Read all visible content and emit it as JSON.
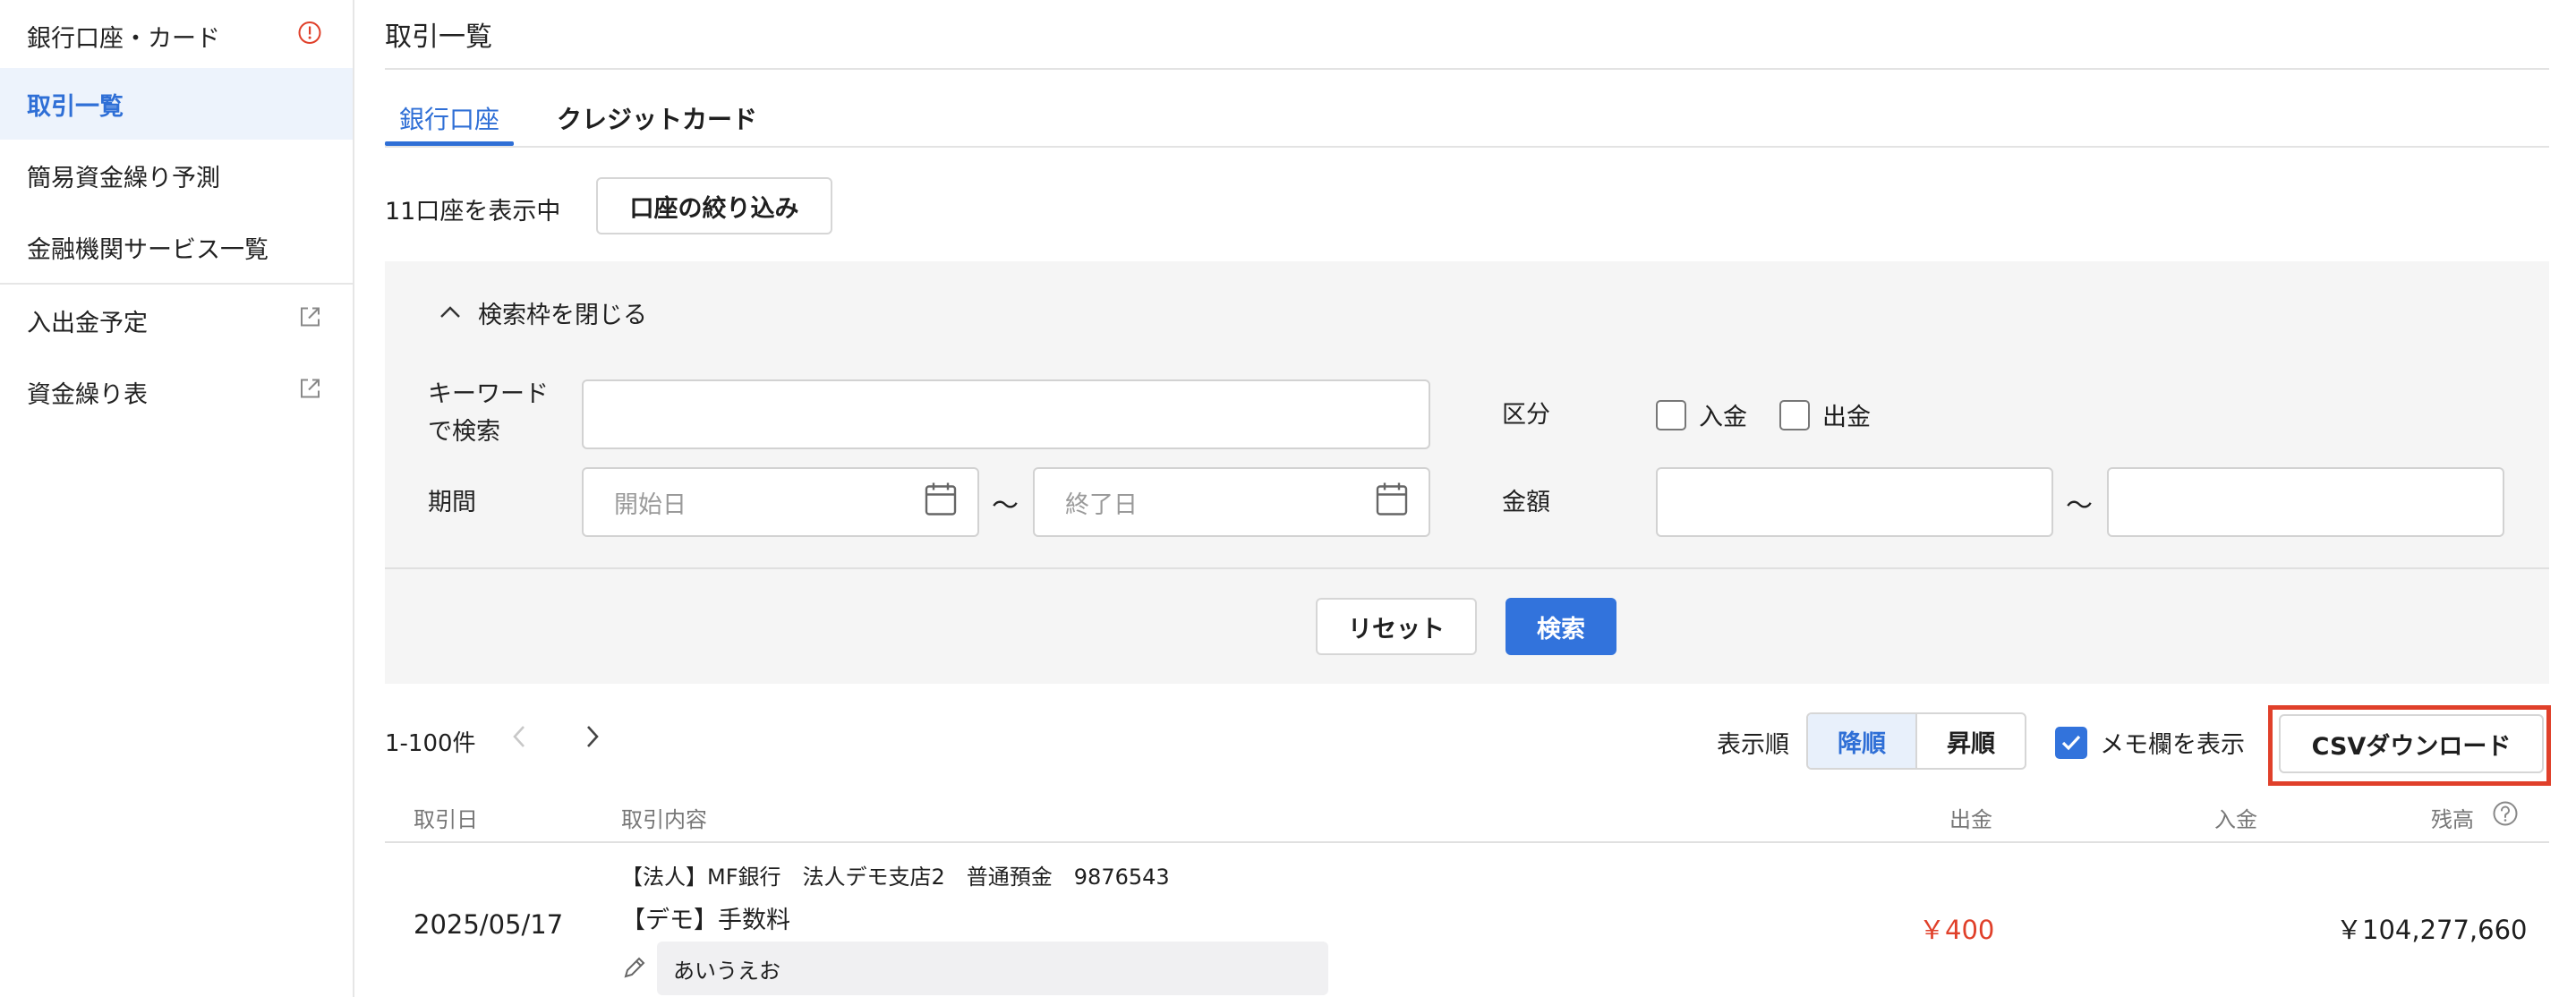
{
  "sidebar": {
    "items": [
      {
        "label": "銀行口座・カード",
        "icon": "alert-circle-icon"
      },
      {
        "label": "取引一覧",
        "active": true
      },
      {
        "label": "簡易資金繰り予測"
      },
      {
        "label": "金融機関サービス一覧"
      },
      {
        "label": "入出金予定",
        "icon": "external-link-icon"
      },
      {
        "label": "資金繰り表",
        "icon": "external-link-icon"
      }
    ]
  },
  "header": {
    "title": "取引一覧"
  },
  "tabs": [
    {
      "label": "銀行口座",
      "active": true
    },
    {
      "label": "クレジットカード"
    }
  ],
  "accounts": {
    "count_text": "11口座を表示中",
    "filter_button": "口座の絞り込み"
  },
  "search": {
    "toggle_label": "検索枠を閉じる",
    "keyword_label_line1": "キーワード",
    "keyword_label_line2": "で検索",
    "keyword_value": "",
    "period_label": "期間",
    "start_placeholder": "開始日",
    "end_placeholder": "終了日",
    "tilde": "〜",
    "category_label": "区分",
    "deposit_label": "入金",
    "withdrawal_label": "出金",
    "amount_label": "金額",
    "reset_button": "リセット",
    "search_button": "検索"
  },
  "results": {
    "range_text": "1-100件",
    "sort_label": "表示順",
    "sort_desc": "降順",
    "sort_asc": "昇順",
    "memo_toggle_label": "メモ欄を表示",
    "memo_toggle_checked": true,
    "csv_button": "CSVダウンロード"
  },
  "table": {
    "headers": {
      "date": "取引日",
      "content": "取引内容",
      "withdrawal": "出金",
      "deposit": "入金",
      "balance": "残高"
    },
    "rows": [
      {
        "date": "2025/05/17",
        "account_info": "【法人】MF銀行　法人デモ支店2　普通預金　9876543",
        "description": "【デモ】手数料",
        "memo": "あいうえお",
        "withdrawal": "￥400",
        "deposit": "",
        "balance": "￥104,277,660"
      }
    ]
  },
  "colors": {
    "accent": "#3273dc",
    "withdrawal_text": "#e0402a",
    "highlight_border": "#e0402a"
  }
}
